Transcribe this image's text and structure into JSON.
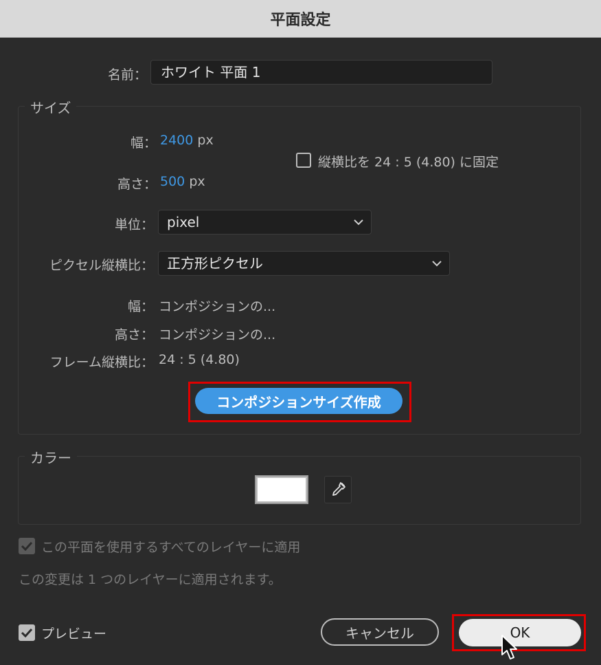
{
  "window": {
    "title": "平面設定"
  },
  "name_row": {
    "label": "名前：",
    "value": "ホワイト 平面 1"
  },
  "size_group": {
    "legend": "サイズ",
    "width_label": "幅：",
    "width_value": "2400",
    "width_unit": "px",
    "height_label": "高さ：",
    "height_value": "500",
    "height_unit": "px",
    "lock_aspect_label": "縦横比を 24 : 5 (4.80) に固定",
    "lock_aspect_checked": false,
    "units_label": "単位：",
    "units_value": "pixel",
    "pixel_aspect_label": "ピクセル縦横比：",
    "pixel_aspect_value": "正方形ピクセル",
    "comp_width_label": "幅：",
    "comp_width_value": "コンポジションの...",
    "comp_height_label": "高さ：",
    "comp_height_value": "コンポジションの...",
    "frame_aspect_label": "フレーム縦横比：",
    "frame_aspect_value": "24 : 5 (4.80)",
    "comp_size_button": "コンポジションサイズ作成"
  },
  "color_group": {
    "legend": "カラー",
    "swatch_color": "#ffffff"
  },
  "apply_all": {
    "label": "この平面を使用するすべてのレイヤーに適用",
    "checked": true,
    "disabled": true
  },
  "info_text": "この変更は 1 つのレイヤーに適用されます。",
  "preview": {
    "label": "プレビュー",
    "checked": true
  },
  "buttons": {
    "cancel": "キャンセル",
    "ok": "OK"
  },
  "colors": {
    "accent": "#3f98e4",
    "highlight": "#e00000",
    "background": "#2b2b2b"
  }
}
